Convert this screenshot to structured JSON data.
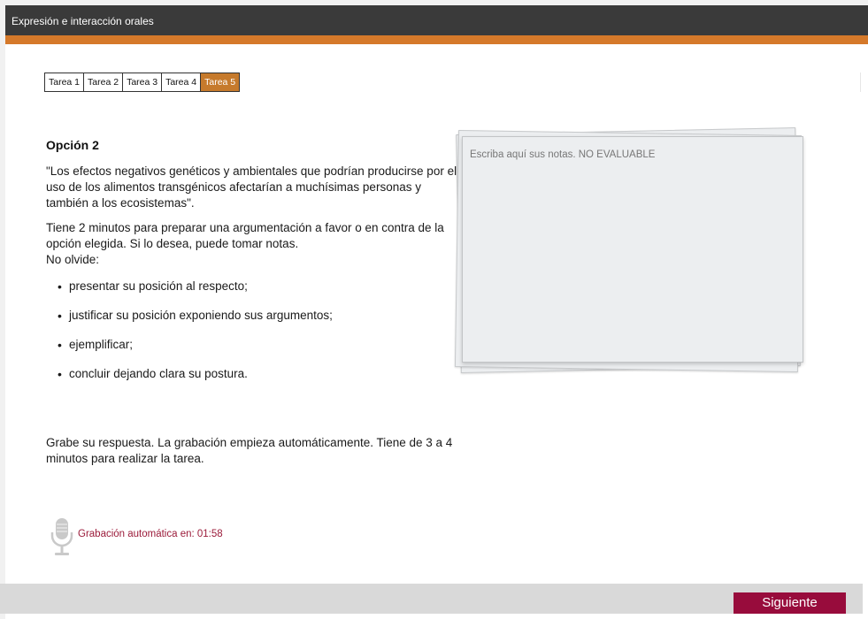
{
  "header": {
    "title": "Expresión e interacción orales"
  },
  "colors": {
    "header_bg": "#3a3a3a",
    "accent": "#d5792a",
    "active_tab": "#c67a2c",
    "timer_text": "#9b1b3a",
    "next_button": "#980c3c"
  },
  "tabs": [
    {
      "label": "Tarea 1",
      "active": false
    },
    {
      "label": "Tarea 2",
      "active": false
    },
    {
      "label": "Tarea 3",
      "active": false
    },
    {
      "label": "Tarea 4",
      "active": false
    },
    {
      "label": "Tarea 5",
      "active": true
    }
  ],
  "task": {
    "heading": "Opción 2",
    "quote": "\"Los efectos negativos genéticos y ambientales que podrían producirse por el uso de los alimentos transgénicos afectarían a muchísimas personas y también a los ecosistemas\".",
    "instructions_1": "Tiene 2 minutos para preparar una argumentación a favor o en contra de la opción elegida. Si lo desea, puede tomar notas.",
    "instructions_2": "No olvide:",
    "points": [
      "presentar su posición al respecto;",
      "justificar su posición exponiendo sus argumentos;",
      "ejemplificar;",
      "concluir dejando clara su postura."
    ],
    "record_text": "Grabe su respuesta. La grabación empieza automáticamente. Tiene de 3 a 4 minutos para realizar la tarea."
  },
  "notes": {
    "placeholder": "Escriba aquí sus notas. NO EVALUABLE",
    "value": ""
  },
  "recording": {
    "label": "Grabación automática en: 01:58",
    "icon": "microphone-icon"
  },
  "footer": {
    "next_label": "Siguiente"
  }
}
